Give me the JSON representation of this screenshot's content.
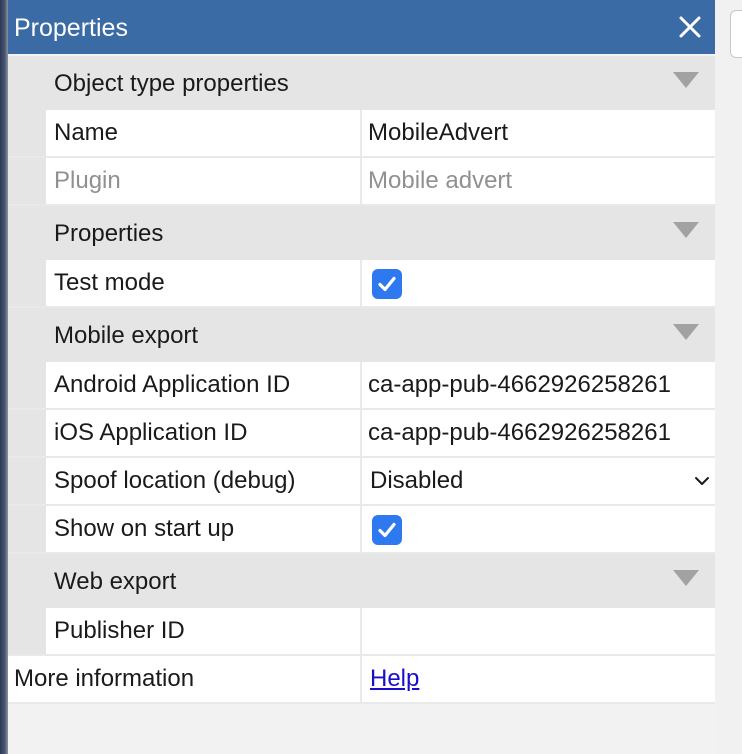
{
  "window": {
    "title": "Properties"
  },
  "sections": {
    "object_type": {
      "label": "Object type properties"
    },
    "properties": {
      "label": "Properties"
    },
    "mobile_export": {
      "label": "Mobile export"
    },
    "web_export": {
      "label": "Web export"
    }
  },
  "rows": {
    "name": {
      "key": "Name",
      "value": "MobileAdvert"
    },
    "plugin": {
      "key": "Plugin",
      "value": "Mobile advert"
    },
    "test_mode": {
      "key": "Test mode",
      "checked": true
    },
    "android_app_id": {
      "key": "Android Application ID",
      "value": "ca-app-pub-4662926258261"
    },
    "ios_app_id": {
      "key": "iOS Application ID",
      "value": "ca-app-pub-4662926258261"
    },
    "spoof_location": {
      "key": "Spoof location (debug)",
      "value": "Disabled"
    },
    "show_on_startup": {
      "key": "Show on start up",
      "checked": true
    },
    "publisher_id": {
      "key": "Publisher ID",
      "value": ""
    }
  },
  "footer": {
    "more_info_label": "More information",
    "help_link": "Help"
  },
  "colors": {
    "titlebar": "#3b6ba4",
    "section_bg": "#e5e5e5",
    "checkbox": "#2f79f0",
    "link": "#1a0dcc"
  },
  "icons": {
    "close": "close-icon",
    "collapse": "triangle-down-icon",
    "checkmark": "checkmark-icon",
    "dropdown": "chevron-down-icon"
  }
}
